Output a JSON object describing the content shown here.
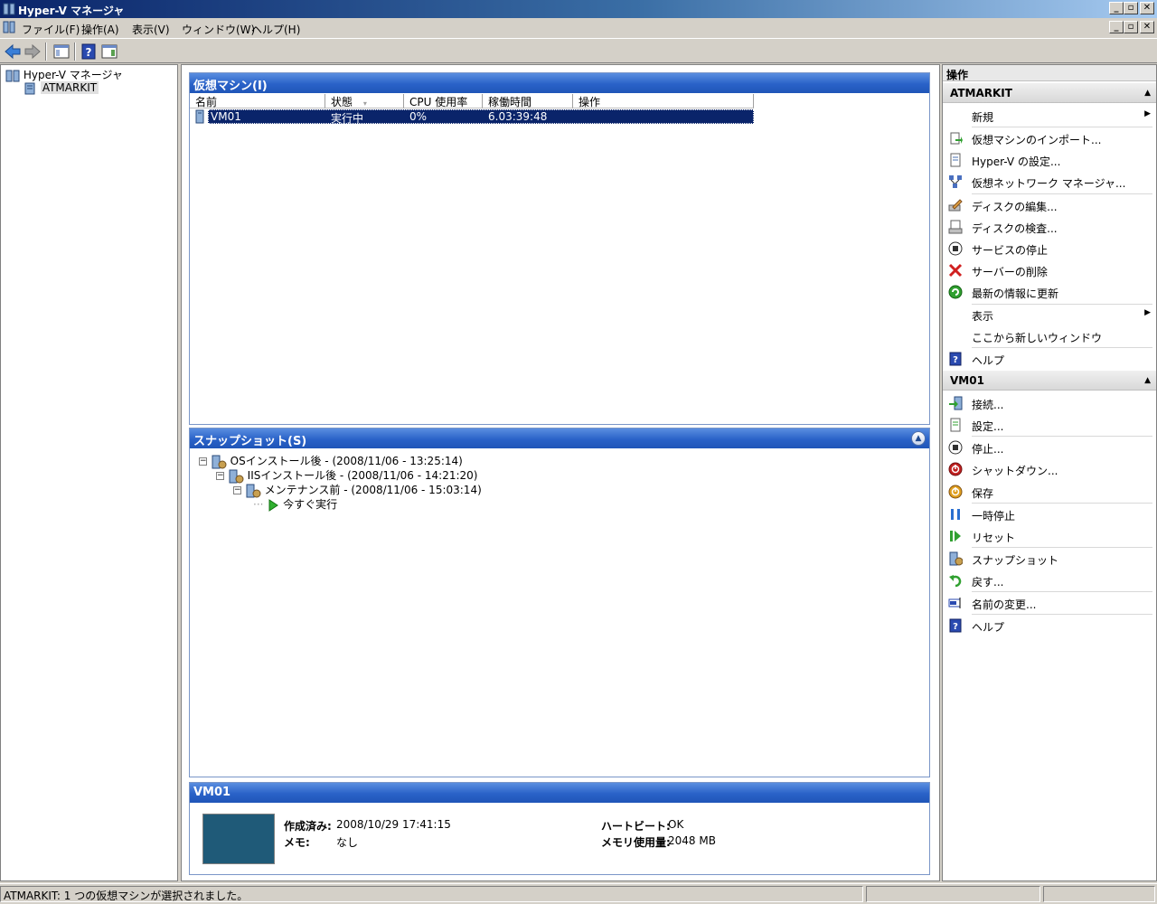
{
  "window": {
    "title": "Hyper-V マネージャ"
  },
  "menu": [
    "ファイル(F)",
    "操作(A)",
    "表示(V)",
    "ウィンドウ(W)",
    "ヘルプ(H)"
  ],
  "tree": {
    "root": "Hyper-V マネージャ",
    "child": "ATMARKIT"
  },
  "vm_section": {
    "title": "仮想マシン(I)",
    "columns": [
      "名前",
      "状態",
      "CPU 使用率",
      "稼働時間",
      "操作"
    ],
    "rows": [
      {
        "name": "VM01",
        "state": "実行中",
        "cpu": "0%",
        "uptime": "6.03:39:48",
        "op": ""
      }
    ]
  },
  "snapshot_section": {
    "title": "スナップショット(S)",
    "items": [
      "OSインストール後 - (2008/11/06 - 13:25:14)",
      "IISインストール後 - (2008/11/06 - 14:21:20)",
      "メンテナンス前 - (2008/11/06 - 15:03:14)",
      "今すぐ実行"
    ]
  },
  "detail_section": {
    "title": "VM01",
    "created_label": "作成済み:",
    "created_value": "2008/10/29 17:41:15",
    "memo_label": "メモ:",
    "memo_value": "なし",
    "heartbeat_label": "ハートビート:",
    "heartbeat_value": "OK",
    "memory_label": "メモリ使用量:",
    "memory_value": "2048 MB"
  },
  "actions": {
    "title": "操作",
    "group1": "ATMARKIT",
    "group1_items": [
      "新規",
      "仮想マシンのインポート...",
      "Hyper-V の設定...",
      "仮想ネットワーク マネージャ...",
      "ディスクの編集...",
      "ディスクの検査...",
      "サービスの停止",
      "サーバーの削除",
      "最新の情報に更新",
      "表示",
      "ここから新しいウィンドウ",
      "ヘルプ"
    ],
    "group2": "VM01",
    "group2_items": [
      "接続...",
      "設定...",
      "停止...",
      "シャットダウン...",
      "保存",
      "一時停止",
      "リセット",
      "スナップショット",
      "戻す...",
      "名前の変更...",
      "ヘルプ"
    ]
  },
  "status": {
    "text": "ATMARKIT:  1 つの仮想マシンが選択されました。"
  }
}
